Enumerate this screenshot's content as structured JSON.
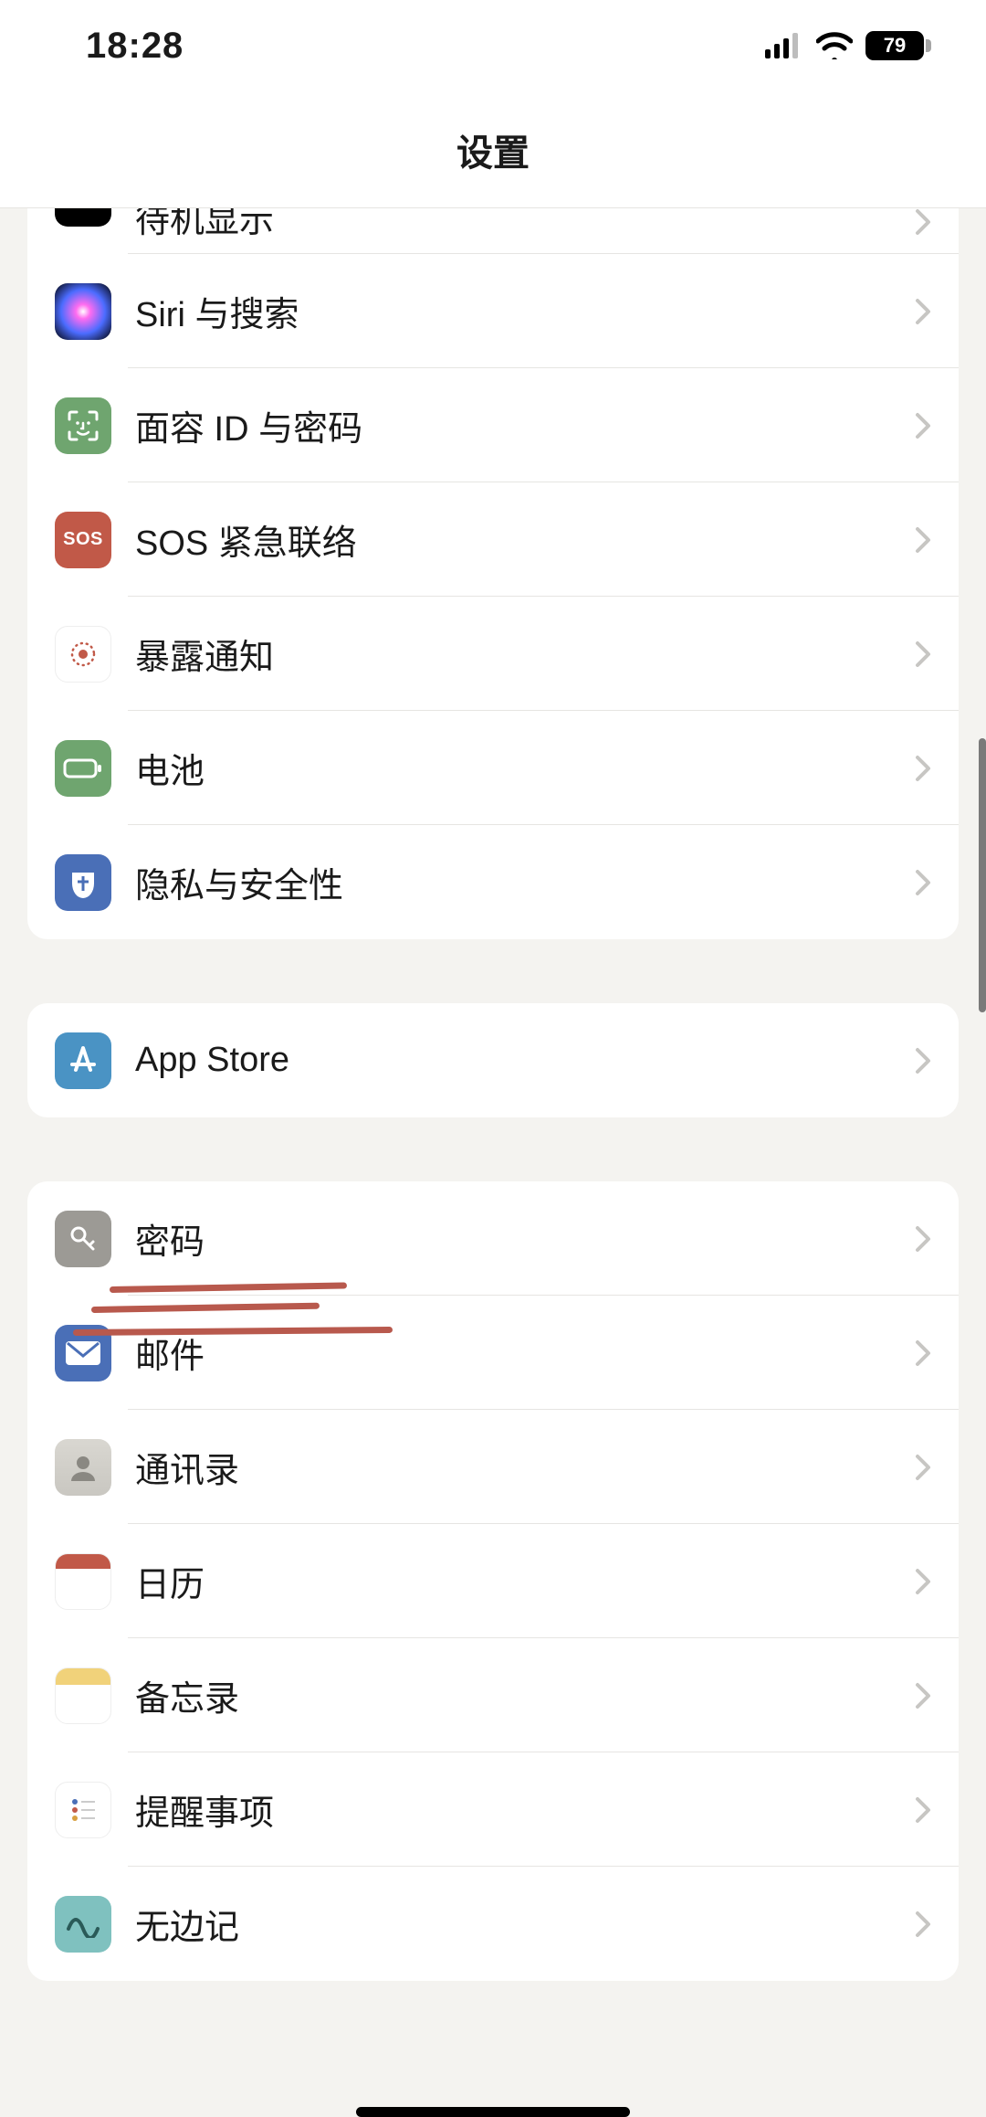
{
  "status": {
    "time": "18:28",
    "battery_pct": "79"
  },
  "nav": {
    "title": "设置"
  },
  "groups": [
    {
      "rows": [
        {
          "key": "standby",
          "label": "待机显示",
          "icon": "standby-icon"
        },
        {
          "key": "siri",
          "label": "Siri 与搜索",
          "icon": "siri-icon"
        },
        {
          "key": "faceid",
          "label": "面容 ID 与密码",
          "icon": "faceid-icon"
        },
        {
          "key": "sos",
          "label": "SOS 紧急联络",
          "icon": "sos-icon"
        },
        {
          "key": "exposure",
          "label": "暴露通知",
          "icon": "exposure-icon"
        },
        {
          "key": "battery",
          "label": "电池",
          "icon": "battery-icon"
        },
        {
          "key": "privacy",
          "label": "隐私与安全性",
          "icon": "privacy-icon"
        }
      ]
    },
    {
      "rows": [
        {
          "key": "appstore",
          "label": "App Store",
          "icon": "appstore-icon"
        }
      ]
    },
    {
      "rows": [
        {
          "key": "passwords",
          "label": "密码",
          "icon": "passwords-icon"
        },
        {
          "key": "mail",
          "label": "邮件",
          "icon": "mail-icon"
        },
        {
          "key": "contacts",
          "label": "通讯录",
          "icon": "contacts-icon"
        },
        {
          "key": "calendar",
          "label": "日历",
          "icon": "calendar-icon"
        },
        {
          "key": "notes",
          "label": "备忘录",
          "icon": "notes-icon"
        },
        {
          "key": "reminders",
          "label": "提醒事项",
          "icon": "reminders-icon"
        },
        {
          "key": "freeform",
          "label": "无边记",
          "icon": "freeform-icon"
        }
      ]
    }
  ],
  "sos_text": "SOS"
}
